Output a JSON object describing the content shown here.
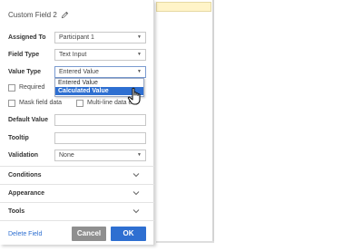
{
  "panel": {
    "title": "Custom Field 2",
    "title_icon": "pencil-icon"
  },
  "fields": {
    "assigned_to": {
      "label": "Assigned To",
      "value": "Participant 1"
    },
    "field_type": {
      "label": "Field Type",
      "value": "Text Input"
    },
    "value_type": {
      "label": "Value Type",
      "value": "Entered Value",
      "options": [
        "Entered Value",
        "Calculated Value"
      ],
      "highlighted_option": "Calculated Value"
    },
    "required": {
      "label": "Required"
    },
    "mask_field_data": {
      "label": "Mask field data"
    },
    "multi_line": {
      "label": "Multi-line data e"
    },
    "default_value": {
      "label": "Default Value",
      "value": ""
    },
    "tooltip": {
      "label": "Tooltip",
      "value": ""
    },
    "validation": {
      "label": "Validation",
      "value": "None"
    }
  },
  "sections": {
    "conditions": "Conditions",
    "appearance": "Appearance",
    "tools": "Tools"
  },
  "footer": {
    "delete_label": "Delete Field",
    "cancel_label": "Cancel",
    "ok_label": "OK"
  },
  "colors": {
    "accent": "#2e6fd1",
    "cancel": "#8f8f8f",
    "field_backdrop": "#fff4c8"
  }
}
